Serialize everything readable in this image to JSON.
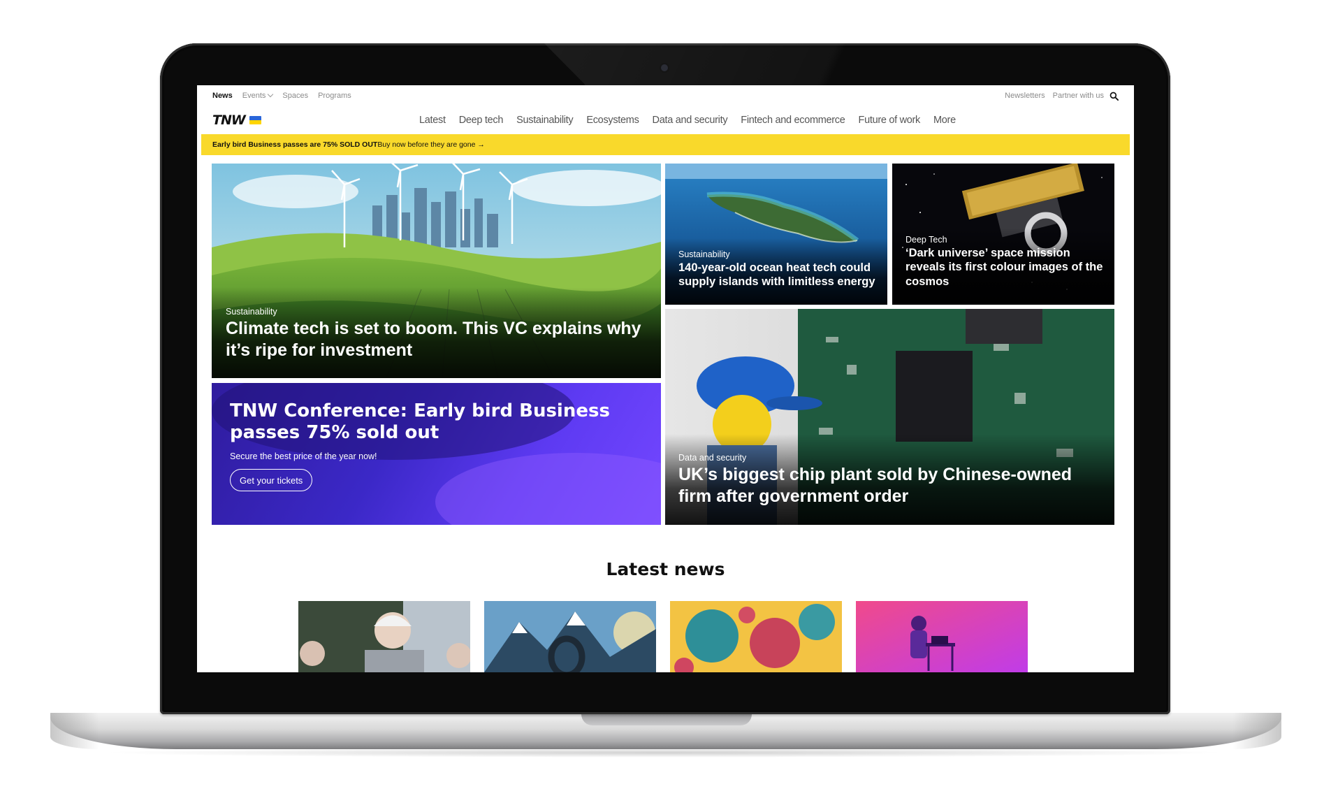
{
  "utility_nav": {
    "items": [
      "News",
      "Events",
      "Spaces",
      "Programs"
    ],
    "right_items": [
      "Newsletters",
      "Partner with us"
    ]
  },
  "brand": {
    "logo": "TNW"
  },
  "categories": [
    "Latest",
    "Deep tech",
    "Sustainability",
    "Ecosystems",
    "Data and security",
    "Fintech and ecommerce",
    "Future of work",
    "More"
  ],
  "banner": {
    "bold": "Early bird Business passes are 75% SOLD OUT",
    "link": "Buy now before they are gone →"
  },
  "featured": [
    {
      "category": "Sustainability",
      "title": "Climate tech is set to boom. This VC explains why it’s ripe for investment"
    },
    {
      "category": "Sustainability",
      "title": "140-year-old ocean heat tech could supply islands with limitless energy"
    },
    {
      "category": "Deep Tech",
      "title": "‘Dark universe’ space mission reveals its first colour images of the cosmos"
    },
    {
      "category": "Data and security",
      "title": "UK’s biggest chip plant sold by Chinese-owned firm after government order"
    }
  ],
  "promo": {
    "title": "TNW Conference: Early bird Business passes 75% sold out",
    "subtitle": "Secure the best price of the year now!",
    "button": "Get your tickets"
  },
  "latest": {
    "heading": "Latest news"
  },
  "colors": {
    "banner": "#f9d92b",
    "promo": "#4a30e0",
    "text": "#111111"
  }
}
